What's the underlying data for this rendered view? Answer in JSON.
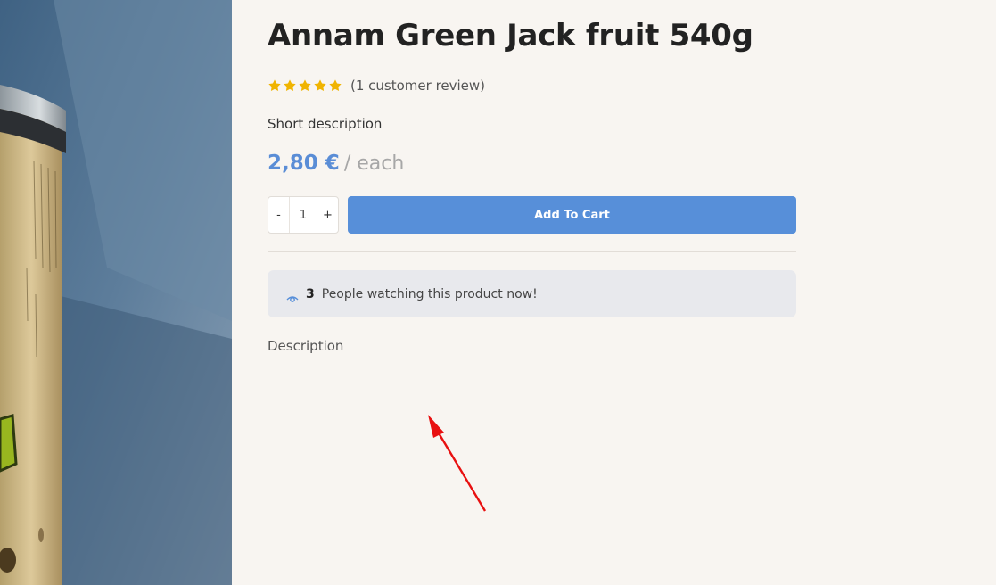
{
  "product": {
    "title": "Annam Green Jack fruit 540g",
    "rating": {
      "stars": 5,
      "max": 5,
      "review_label": "(1 customer review)"
    },
    "short_description_label": "Short description",
    "price": {
      "amount": "2,80 €",
      "unit": "/ each"
    },
    "quantity": {
      "minus_label": "-",
      "value": "1",
      "plus_label": "+"
    },
    "add_to_cart_label": "Add To Cart",
    "watching": {
      "count": "3",
      "text": "People watching this product now!"
    },
    "description_label": "Description"
  },
  "colors": {
    "accent": "#578fd9",
    "price": "#5a8dd6",
    "star": "#f0b400",
    "watching_bg": "#e8e9ed",
    "annotation_arrow": "#e81010"
  },
  "icons": [
    "star-icon",
    "eye-icon",
    "annotation-arrow-icon"
  ]
}
